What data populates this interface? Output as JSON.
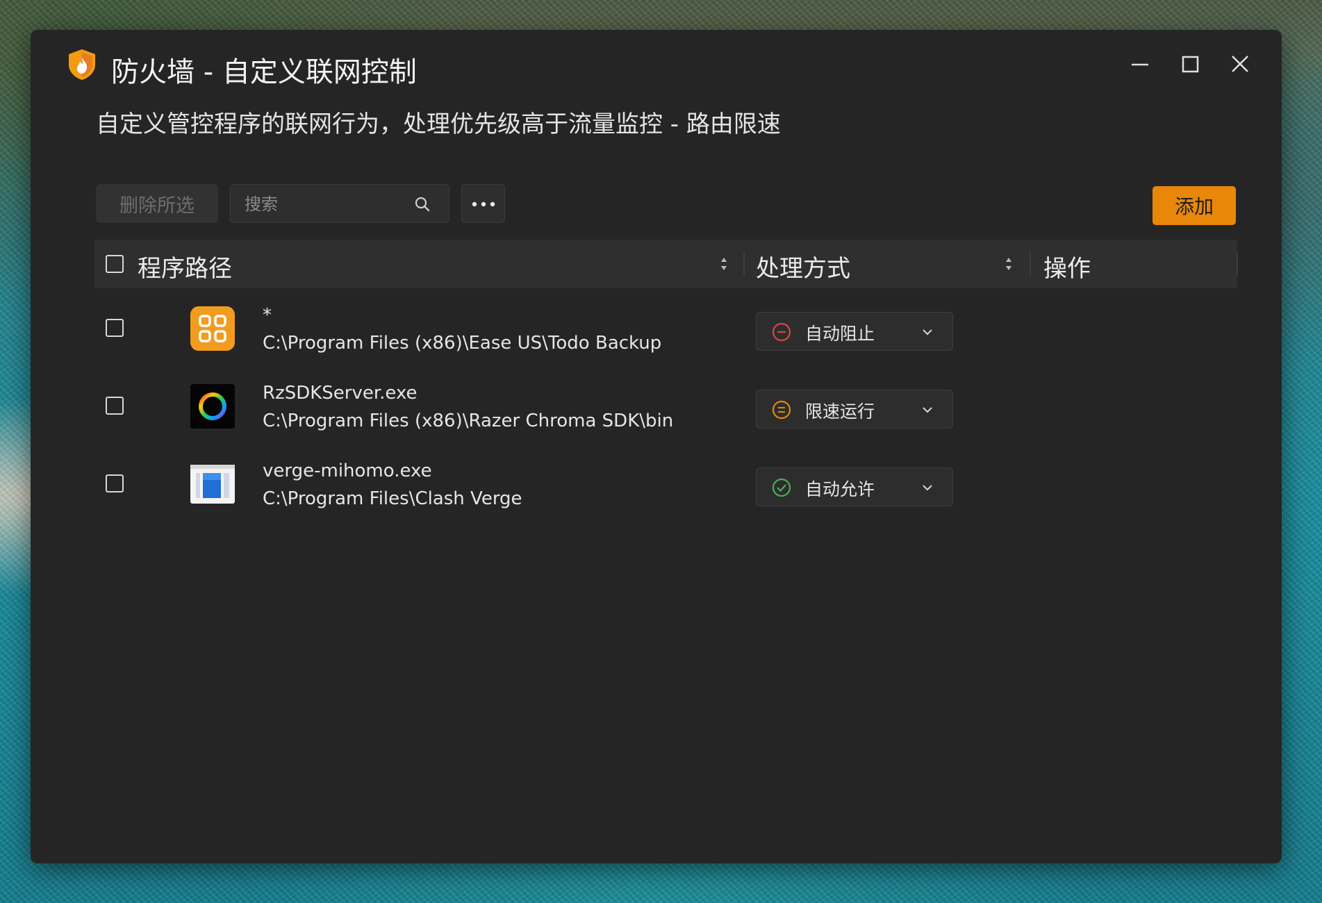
{
  "window": {
    "title": "防火墙 - 自定义联网控制",
    "subtitle": "自定义管控程序的联网行为，处理优先级高于流量监控 - 路由限速",
    "accent": "#e8870a"
  },
  "toolbar": {
    "delete_label": "删除所选",
    "search_placeholder": "搜索",
    "more_icon": "more-dots-icon",
    "add_label": "添加"
  },
  "table": {
    "headers": {
      "path": "程序路径",
      "mode": "处理方式",
      "ops": "操作"
    },
    "rows": [
      {
        "name": "*",
        "path": "C:\\Program Files (x86)\\Ease US\\Todo Backup",
        "icon": "apps-grid-icon",
        "mode": "自动阻止",
        "mode_icon": "block-circle-icon",
        "mode_color": "#d9473f"
      },
      {
        "name": "RzSDKServer.exe",
        "path": "C:\\Program Files (x86)\\Razer Chroma SDK\\bin",
        "icon": "chroma-ring-icon",
        "mode": "限速运行",
        "mode_icon": "limit-circle-icon",
        "mode_color": "#e8870a"
      },
      {
        "name": "verge-mihomo.exe",
        "path": "C:\\Program Files\\Clash Verge",
        "icon": "window-app-icon",
        "mode": "自动允许",
        "mode_icon": "check-circle-icon",
        "mode_color": "#4caf50"
      }
    ]
  }
}
